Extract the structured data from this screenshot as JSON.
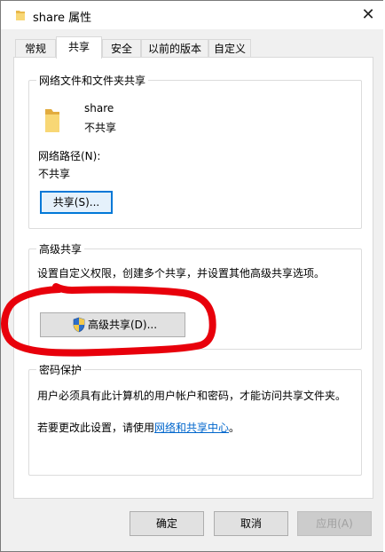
{
  "window": {
    "title": "share 属性",
    "close_glyph": "✕"
  },
  "tabs": [
    {
      "label": "常规",
      "active": false
    },
    {
      "label": "共享",
      "active": true
    },
    {
      "label": "安全",
      "active": false
    },
    {
      "label": "以前的版本",
      "active": false
    },
    {
      "label": "自定义",
      "active": false
    }
  ],
  "network_sharing": {
    "group_title": "网络文件和文件夹共享",
    "folder_name": "share",
    "share_status": "不共享",
    "network_path_label": "网络路径(N):",
    "network_path_value": "不共享",
    "share_button": "共享(S)..."
  },
  "advanced_sharing": {
    "group_title": "高级共享",
    "description": "设置自定义权限，创建多个共享，并设置其他高级共享选项。",
    "button": "高级共享(D)..."
  },
  "password_protection": {
    "group_title": "密码保护",
    "description": "用户必须具有此计算机的用户帐户和密码，才能访问共享文件夹。",
    "change_prefix": "若要更改此设置，请使用",
    "link": "网络和共享中心",
    "change_suffix": "。"
  },
  "footer": {
    "ok": "确定",
    "cancel": "取消",
    "apply": "应用(A)"
  },
  "icons": {
    "title_icon": "folder-icon",
    "folder_icon": "folder-icon",
    "shield_icon": "uac-shield-icon",
    "close_icon": "close-icon"
  },
  "colors": {
    "annotation": "#e8000b",
    "focus": "#0078d7",
    "link": "#0066cc",
    "folder": "#f8d775"
  }
}
